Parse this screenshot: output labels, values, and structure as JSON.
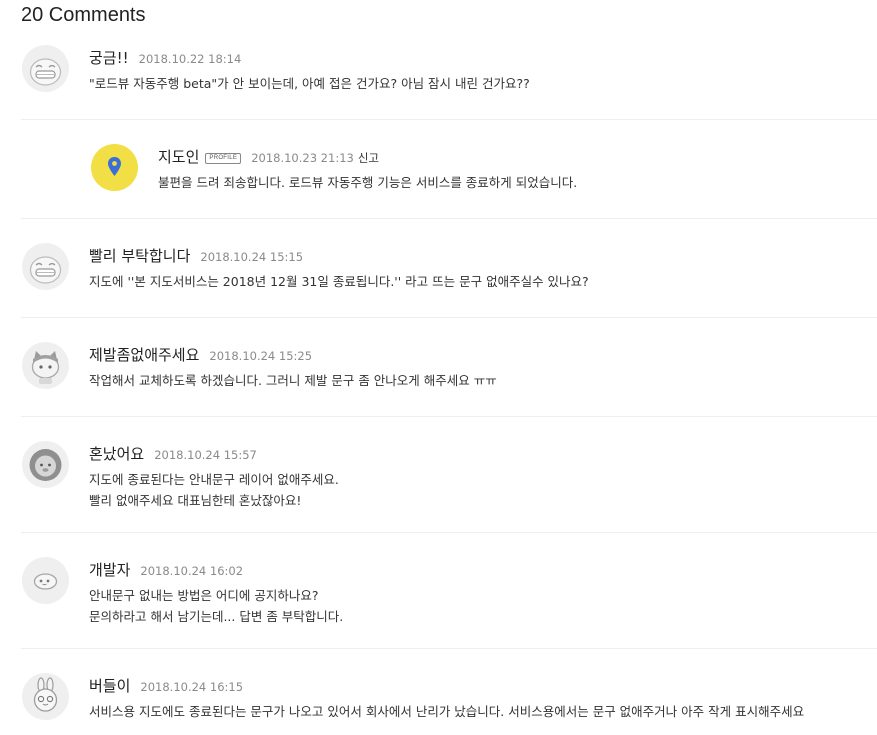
{
  "heading": "20 Comments",
  "comments": [
    {
      "author": "궁금!!",
      "date": "2018.10.22 18:14",
      "lines": [
        "\"로드뷰 자동주행 beta\"가 안 보이는데, 아예 접은 건가요? 아님 잠시 내린 건가요??"
      ],
      "avatar_icon": "grinning-character-icon"
    },
    {
      "author": "지도인",
      "badge": "PROFILE",
      "date": "2018.10.23 21:13",
      "report": "신고",
      "lines": [
        "불편을 드려 죄송합니다. 로드뷰 자동주행 기능은 서비스를 종료하게 되었습니다."
      ],
      "avatar_icon": "map-pin-icon",
      "avatar_color": "#f2df45",
      "pin_color": "#3b6fd6"
    },
    {
      "author": "빨리 부탁합니다",
      "date": "2018.10.24 15:15",
      "lines": [
        "지도에 ''본 지도서비스는 2018년 12월 31일 종료됩니다.'' 라고 뜨는 문구 없애주실수 있나요?"
      ],
      "avatar_icon": "grinning-character-icon"
    },
    {
      "author": "제발좀없애주세요",
      "date": "2018.10.24 15:25",
      "lines": [
        "작업해서 교체하도록 하겠습니다. 그러니 제발 문구 좀 안나오게 해주세요 ㅠㅠ"
      ],
      "avatar_icon": "cat-character-icon"
    },
    {
      "author": "혼났어요",
      "date": "2018.10.24 15:57",
      "lines": [
        "지도에 종료된다는 안내문구 레이어 없애주세요.",
        "빨리 없애주세요 대표님한테 혼났잖아요!"
      ],
      "avatar_icon": "lion-character-icon"
    },
    {
      "author": "개발자",
      "date": "2018.10.24 16:02",
      "lines": [
        "안내문구 없내는 방법은 어디에 공지하나요?",
        "문의하라고 해서 남기는데... 답변 좀 부탁합니다."
      ],
      "avatar_icon": "peach-character-icon"
    },
    {
      "author": "버들이",
      "date": "2018.10.24 16:15",
      "lines": [
        "서비스용 지도에도 종료된다는 문구가 나오고 있어서 회사에서 난리가 났습니다. 서비스용에서는 문구 없애주거나 아주 작게 표시해주세요"
      ],
      "avatar_icon": "rabbit-character-icon"
    }
  ]
}
